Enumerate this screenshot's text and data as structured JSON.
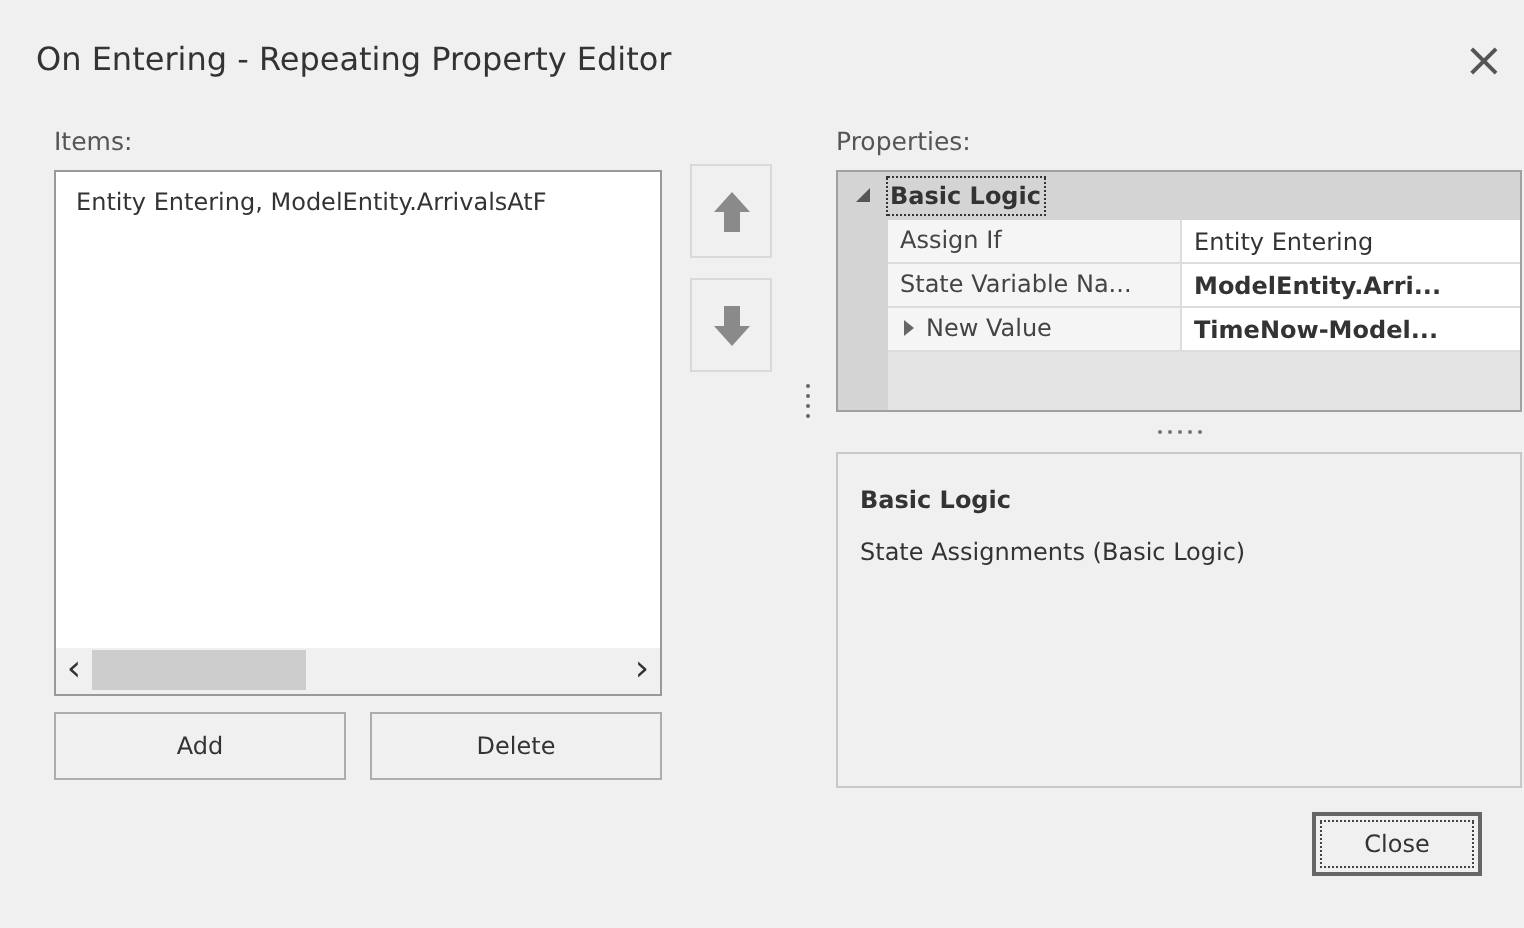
{
  "window": {
    "title": "On Entering - Repeating Property Editor",
    "close": "×"
  },
  "items": {
    "label": "Items:",
    "entries": [
      {
        "text": "Entity Entering, ModelEntity.ArrivalsAtF",
        "selected": false
      }
    ],
    "scroll_left": "‹",
    "scroll_right": "›"
  },
  "buttons": [
    "Add",
    "Delete"
  ],
  "properties": {
    "label": "Properties:",
    "categories": [
      {
        "name": "Basic Logic",
        "expanded": true,
        "selected": true,
        "rows": [
          {
            "name": "Assign If",
            "value": "Entity Entering",
            "modified": false,
            "expandable": false
          },
          {
            "name": "State Variable Na...",
            "value": "ModelEntity.Arri...",
            "modified": true,
            "expandable": false
          },
          {
            "name": "New Value",
            "value": "TimeNow-Model...",
            "modified": true,
            "expandable": true,
            "expanded": false
          }
        ]
      }
    ]
  },
  "description": {
    "title": "Basic Logic",
    "text": "State Assignments (Basic Logic)"
  },
  "close_button": {
    "label": "Close",
    "focused": true
  }
}
